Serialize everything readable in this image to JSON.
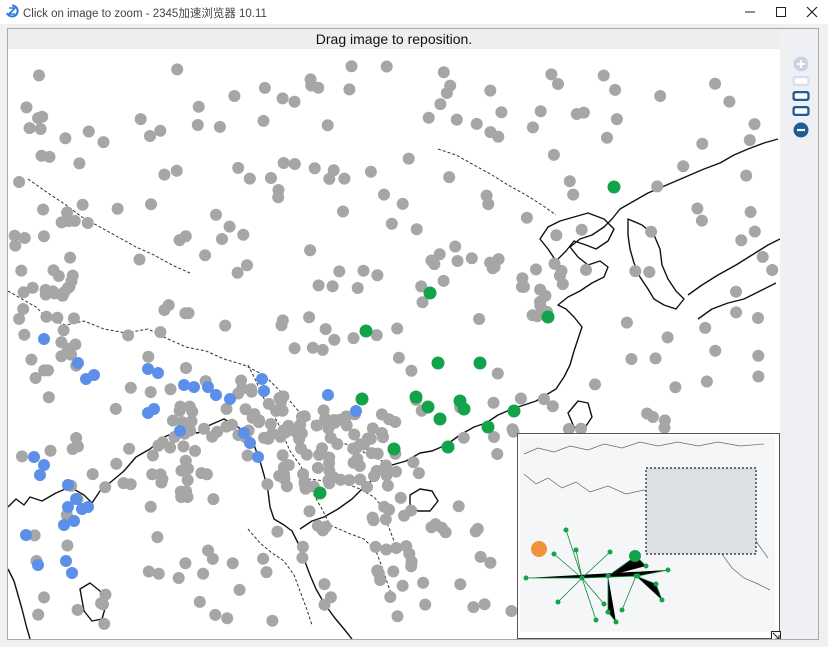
{
  "window": {
    "title": "Click on image to zoom - 2345加速浏览器 10.11",
    "app_icon": "browser-logo-icon",
    "controls": [
      "minimize-icon",
      "maximize-icon",
      "close-icon"
    ]
  },
  "viewer": {
    "hint": "Drag image to reposition.",
    "zoom_controls": [
      "zoom-in-icon",
      "zoom-level-1",
      "zoom-level-2",
      "zoom-level-3",
      "zoom-out-icon"
    ]
  },
  "map": {
    "marker_colors": {
      "grey": "#a6a6a6",
      "blue": "#5b8fe8",
      "green": "#13a34a"
    },
    "minimap_highlight": "#d9dde2",
    "accent": "#1f5c8f"
  }
}
